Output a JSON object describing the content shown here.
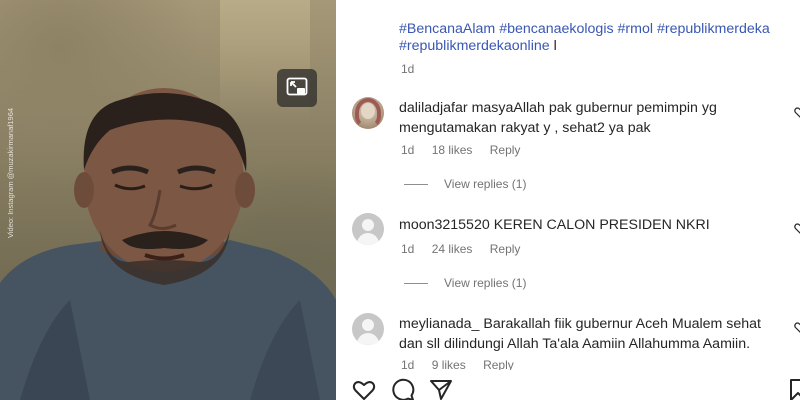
{
  "video": {
    "watermark": "Video: Instagram @muzakirmanaf1964",
    "pip_icon": "picture-in-picture-icon"
  },
  "caption": {
    "hashtags": [
      "#BencanaAlam",
      "#bencanaekologis",
      "#rmol",
      "#republikmerdeka",
      "#republikmerdekaonline"
    ],
    "cursor": "l",
    "time": "1d"
  },
  "comments": [
    {
      "username": "daliladjafar",
      "text": "masyaAllah pak gubernur pemimpin yg mengutamakan rakyat y , sehat2 ya pak",
      "time": "1d",
      "likes": "18 likes",
      "reply_label": "Reply",
      "view_replies": "View replies (1)",
      "avatar": "photo"
    },
    {
      "username": "moon3215520",
      "text": "KEREN CALON PRESIDEN NKRI",
      "time": "1d",
      "likes": "24 likes",
      "reply_label": "Reply",
      "view_replies": "View replies (1)",
      "avatar": "default"
    },
    {
      "username": "meylianada_",
      "text": "Barakallah fiik gubernur Aceh Mualem sehat dan sll dilindungi Allah Ta'ala Aamiin Allahumma Aamiin.",
      "time": "1d",
      "likes": "9 likes",
      "reply_label": "Reply",
      "avatar": "default"
    }
  ],
  "actions": {
    "like_icon": "heart-icon",
    "comment_icon": "comment-icon",
    "share_icon": "share-icon",
    "save_icon": "bookmark-icon"
  }
}
